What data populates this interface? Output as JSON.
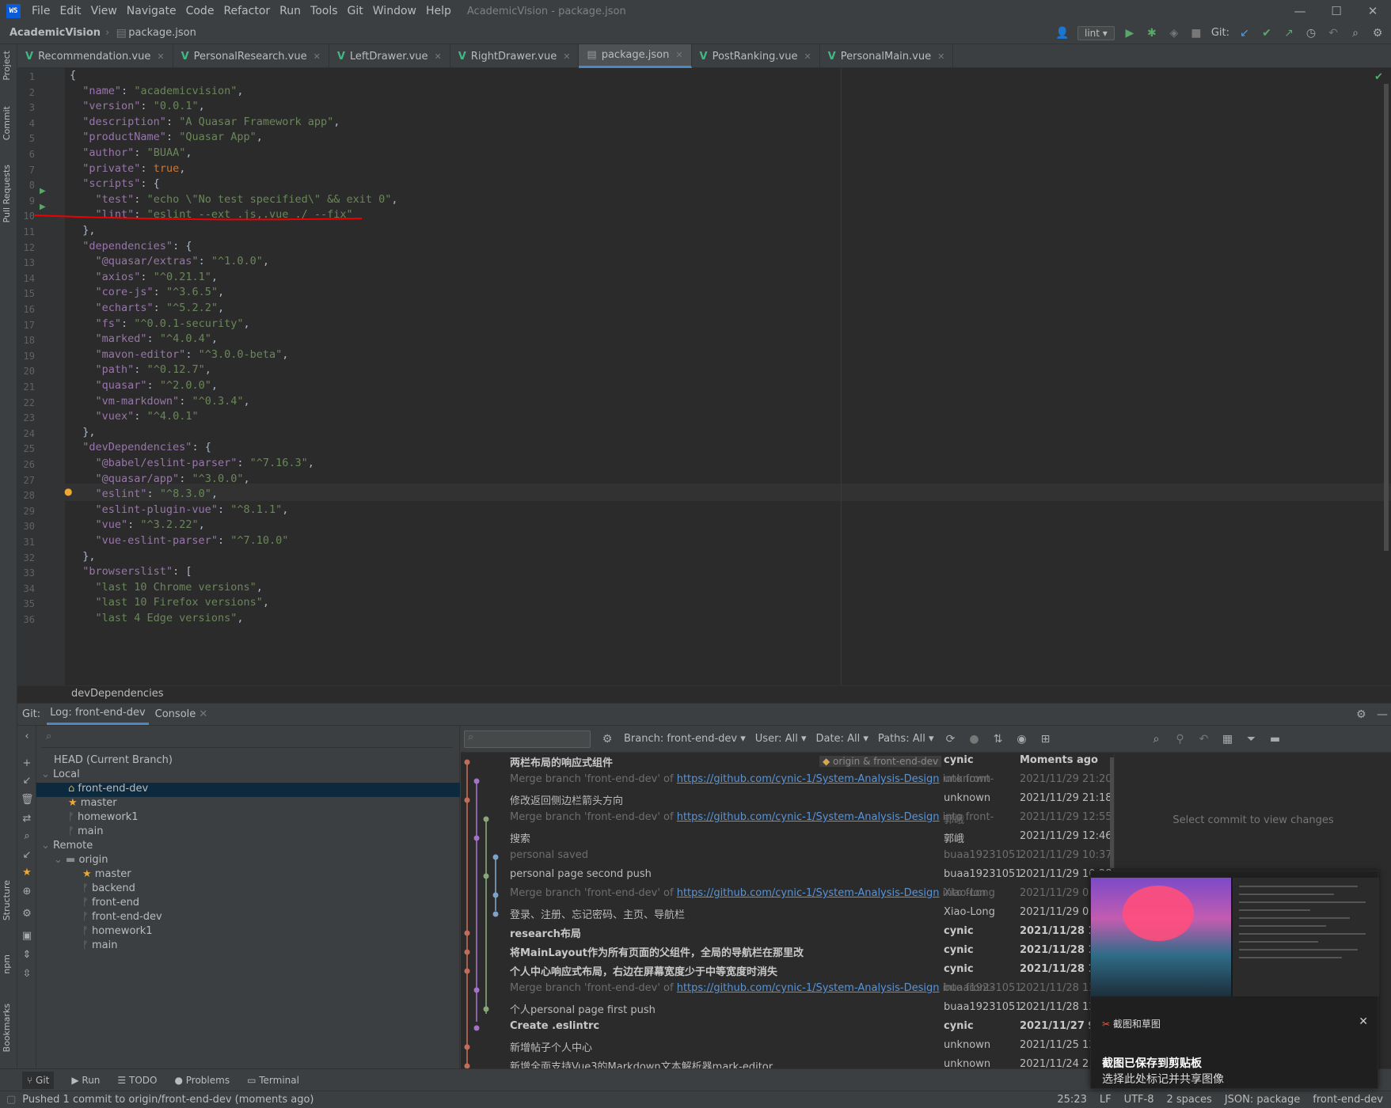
{
  "window": {
    "title": "AcademicVision - package.json",
    "menu": [
      "File",
      "Edit",
      "View",
      "Navigate",
      "Code",
      "Refactor",
      "Run",
      "Tools",
      "Git",
      "Window",
      "Help"
    ]
  },
  "navbar": {
    "project": "AcademicVision",
    "file": "package.json",
    "run_config": "lint",
    "git_label": "Git:"
  },
  "tabs": [
    {
      "label": "Recommendation.vue",
      "type": "vue"
    },
    {
      "label": "PersonalResearch.vue",
      "type": "vue"
    },
    {
      "label": "LeftDrawer.vue",
      "type": "vue"
    },
    {
      "label": "RightDrawer.vue",
      "type": "vue"
    },
    {
      "label": "package.json",
      "type": "json",
      "active": true
    },
    {
      "label": "PostRanking.vue",
      "type": "vue"
    },
    {
      "label": "PersonalMain.vue",
      "type": "vue"
    }
  ],
  "side_tools": [
    "Project",
    "Commit",
    "Pull Requests",
    "Structure",
    "npm",
    "Bookmarks"
  ],
  "code_lines": [
    "{",
    "  \"name\": \"academicvision\",",
    "  \"version\": \"0.0.1\",",
    "  \"description\": \"A Quasar Framework app\",",
    "  \"productName\": \"Quasar App\",",
    "  \"author\": \"BUAA\",",
    "  \"private\": true,",
    "  \"scripts\": {",
    "    \"test\": \"echo \\\"No test specified\\\" && exit 0\",",
    "    \"lint\": \"eslint --ext .js,.vue ./ --fix\"",
    "  },",
    "  \"dependencies\": {",
    "    \"@quasar/extras\": \"^1.0.0\",",
    "    \"axios\": \"^0.21.1\",",
    "    \"core-js\": \"^3.6.5\",",
    "    \"echarts\": \"^5.2.2\",",
    "    \"fs\": \"^0.0.1-security\",",
    "    \"marked\": \"^4.0.4\",",
    "    \"mavon-editor\": \"^3.0.0-beta\",",
    "    \"path\": \"^0.12.7\",",
    "    \"quasar\": \"^2.0.0\",",
    "    \"vm-markdown\": \"^0.3.4\",",
    "    \"vuex\": \"^4.0.1\"",
    "  },",
    "  \"devDependencies\": {",
    "    \"@babel/eslint-parser\": \"^7.16.3\",",
    "    \"@quasar/app\": \"^3.0.0\",",
    "    \"eslint\": \"^8.3.0\",",
    "    \"eslint-plugin-vue\": \"^8.1.1\",",
    "    \"vue\": \"^3.2.22\",",
    "    \"vue-eslint-parser\": \"^7.10.0\"",
    "  },",
    "  \"browserslist\": [",
    "    \"last 10 Chrome versions\",",
    "    \"last 10 Firefox versions\",",
    "    \"last 4 Edge versions\","
  ],
  "breadcrumb": "devDependencies",
  "git": {
    "label": "Git:",
    "tab_log": "Log: front-end-dev",
    "tab_console": "Console",
    "branches": {
      "head": "HEAD (Current Branch)",
      "local": "Local",
      "local_items": [
        "front-end-dev",
        "master",
        "homework1",
        "main"
      ],
      "remote": "Remote",
      "origin": "origin",
      "remote_items": [
        "master",
        "backend",
        "front-end",
        "front-end-dev",
        "homework1",
        "main"
      ]
    },
    "filters": [
      "Branch: front-end-dev",
      "User: All",
      "Date: All",
      "Paths: All"
    ],
    "detail_hint": "Select commit to view changes",
    "commits": [
      {
        "msg": "两栏布局的响应式组件",
        "tag": "origin & front-end-dev",
        "author": "cynic",
        "date": "Moments ago",
        "style": "bold"
      },
      {
        "msg": "Merge branch 'front-end-dev' of ",
        "link": "https://github.com/cynic-1/System-Analysis-Design",
        "tail": " into front-",
        "author": "unknown",
        "date": "2021/11/29 21:20",
        "style": "dim"
      },
      {
        "msg": "修改返回侧边栏箭头方向",
        "author": "unknown",
        "date": "2021/11/29 21:18",
        "style": ""
      },
      {
        "msg": "Merge branch 'front-end-dev' of ",
        "link": "https://github.com/cynic-1/System-Analysis-Design",
        "tail": " into front-",
        "author": "郭峨",
        "date": "2021/11/29 12:55",
        "style": "dim"
      },
      {
        "msg": "搜索",
        "author": "郭峨",
        "date": "2021/11/29 12:46",
        "style": ""
      },
      {
        "msg": "personal saved",
        "author": "buaa19231051",
        "date": "2021/11/29 10:37",
        "style": "dim"
      },
      {
        "msg": "personal page second push",
        "author": "buaa19231051",
        "date": "2021/11/29 10:28",
        "style": ""
      },
      {
        "msg": "Merge branch 'front-end-dev' of ",
        "link": "https://github.com/cynic-1/System-Analysis-Design",
        "tail": " into fron",
        "author": "Xiao-Long",
        "date": "2021/11/29 0:27",
        "style": "dim"
      },
      {
        "msg": "登录、注册、忘记密码、主页、导航栏",
        "author": "Xiao-Long",
        "date": "2021/11/29 0:13",
        "style": ""
      },
      {
        "msg": "research布局",
        "author": "cynic",
        "date": "2021/11/28 15:41",
        "style": "bold"
      },
      {
        "msg": "将MainLayout作为所有页面的父组件，全局的导航栏在那里改",
        "author": "cynic",
        "date": "2021/11/28 14:55",
        "style": "bold"
      },
      {
        "msg": "个人中心响应式布局，右边在屏幕宽度少于中等宽度时消失",
        "author": "cynic",
        "date": "2021/11/28 13:36",
        "style": "bold"
      },
      {
        "msg": "Merge branch 'front-end-dev' of ",
        "link": "https://github.com/cynic-1/System-Analysis-Design",
        "tail": " into front-",
        "author": "buaa19231051",
        "date": "2021/11/28 12:29",
        "style": "dim"
      },
      {
        "msg": "个人personal page first push",
        "author": "buaa19231051",
        "date": "2021/11/28 12:02",
        "style": ""
      },
      {
        "msg": "Create .eslintrc",
        "author": "cynic",
        "date": "2021/11/27 9:03",
        "style": "bold"
      },
      {
        "msg": "新增帖子个人中心",
        "author": "unknown",
        "date": "2021/11/25 12:48",
        "style": ""
      },
      {
        "msg": "新增全面支持Vue3的Markdown文本解析器mark-editor",
        "author": "unknown",
        "date": "2021/11/24 2:23",
        "style": ""
      }
    ]
  },
  "bottom_tools": [
    "Git",
    "Run",
    "TODO",
    "Problems",
    "Terminal"
  ],
  "status": {
    "message": "Pushed 1 commit to origin/front-end-dev (moments ago)",
    "position": "25:23",
    "line_sep": "LF",
    "encoding": "UTF-8",
    "indent": "2 spaces",
    "schema": "JSON: package",
    "branch": "front-end-dev"
  },
  "toast": {
    "app": "截图和草图",
    "title": "截图已保存到剪贴板",
    "body": "选择此处标记并共享图像"
  }
}
